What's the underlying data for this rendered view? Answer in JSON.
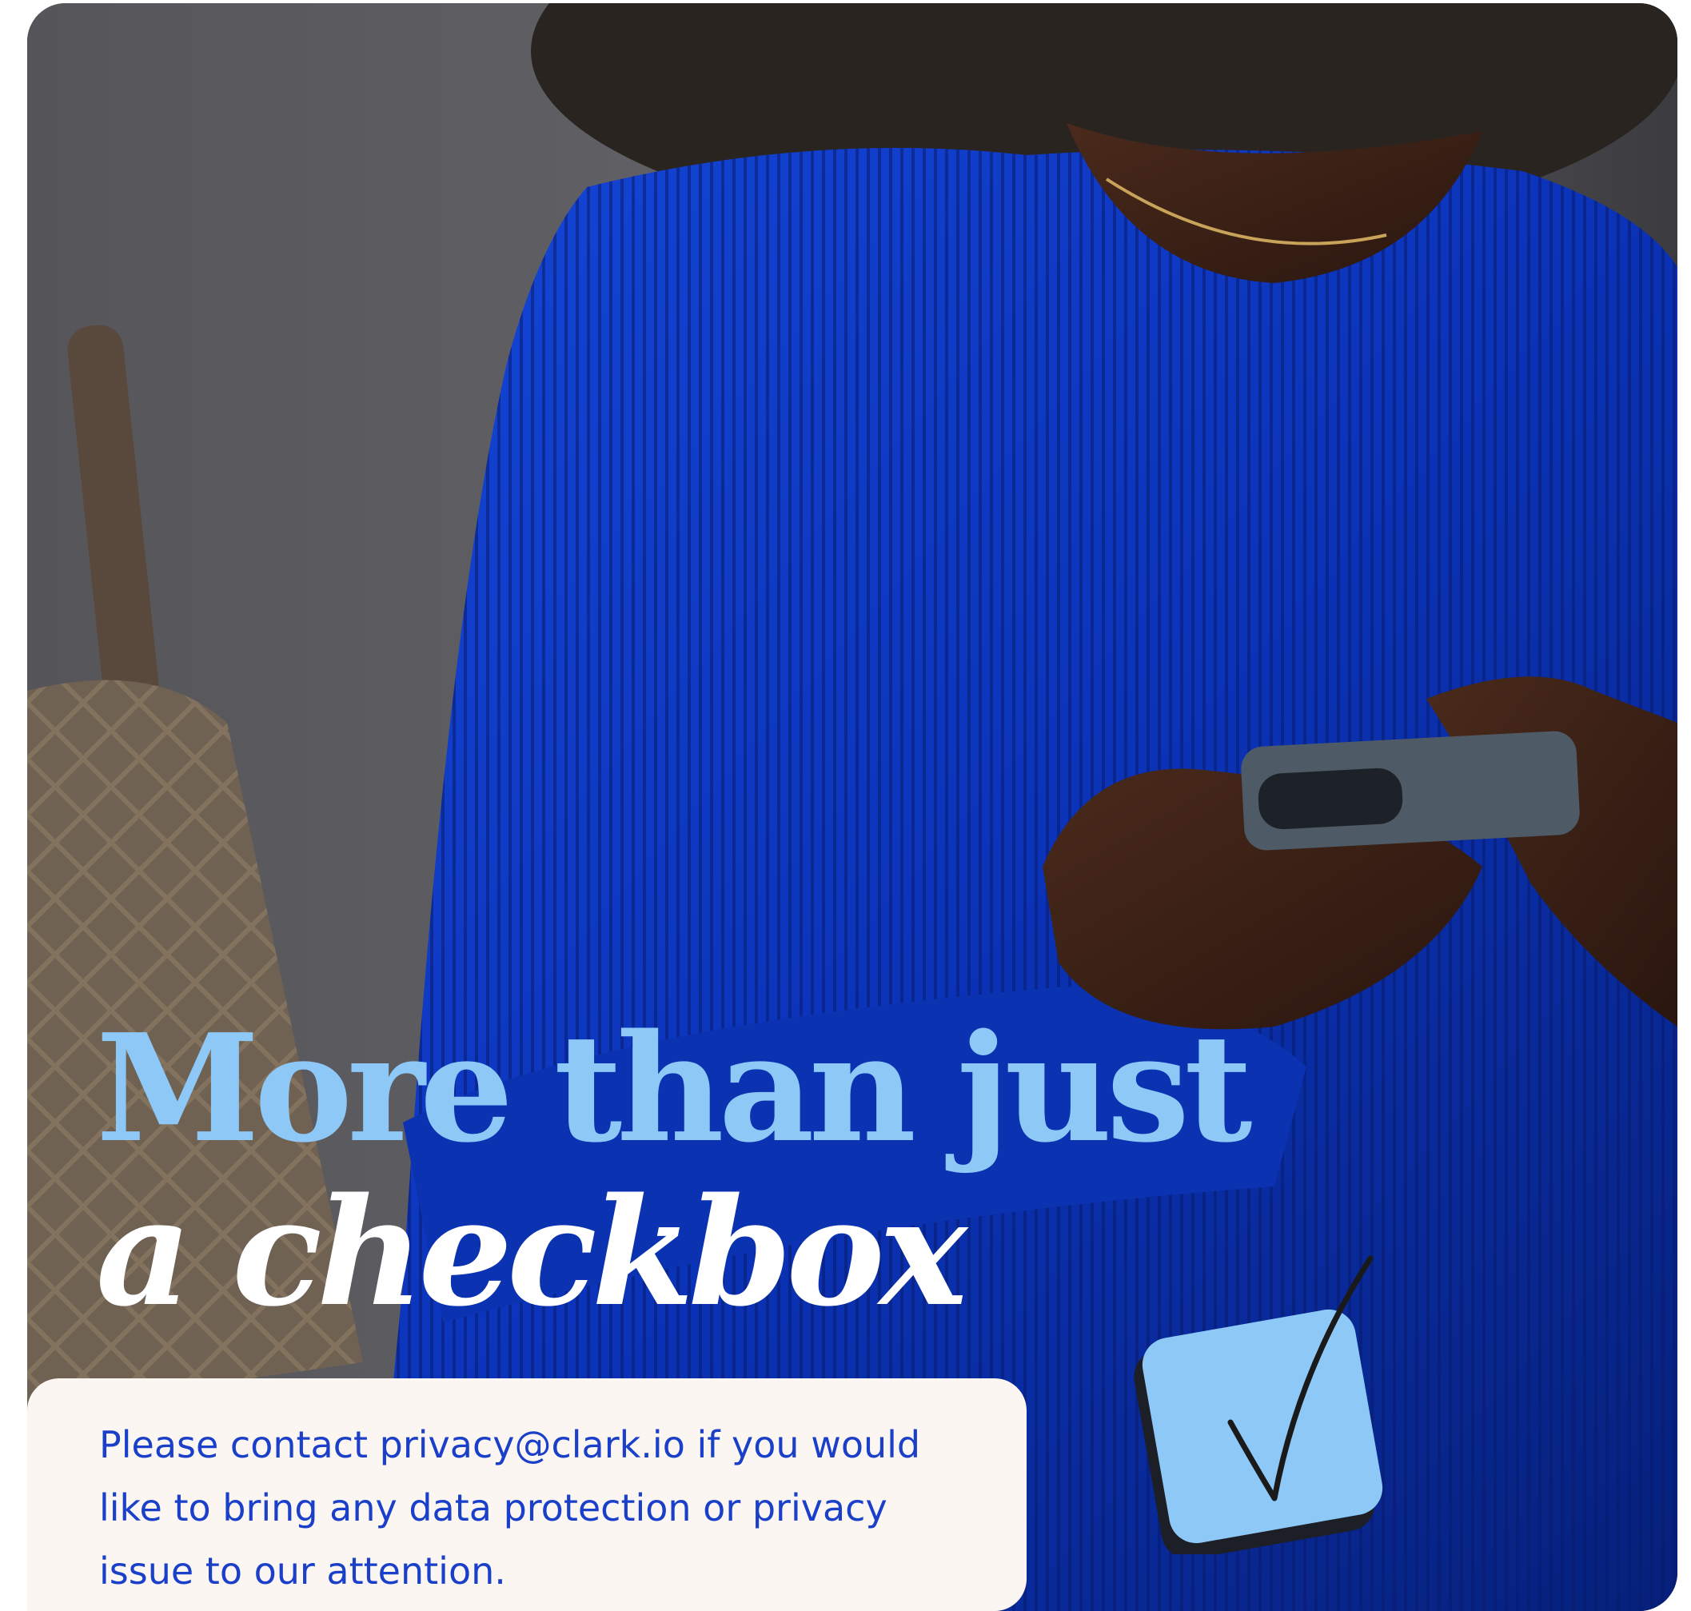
{
  "hero": {
    "headline_line1": "More than just",
    "headline_line2": "a checkbox"
  },
  "contact": {
    "text": "Please contact privacy@clark.io if you would like to bring any data protection or privacy issue to our attention."
  },
  "icons": {
    "checkbox": "checkbox-checked-icon"
  },
  "colors": {
    "sweater_blue": "#0a2ba8",
    "headline_light_blue": "#8dc8f7",
    "headline_white": "#ffffff",
    "contact_box_bg": "#fcf6f2",
    "contact_text": "#1a3fc8",
    "checkbox_fill": "#8dc8f7"
  }
}
